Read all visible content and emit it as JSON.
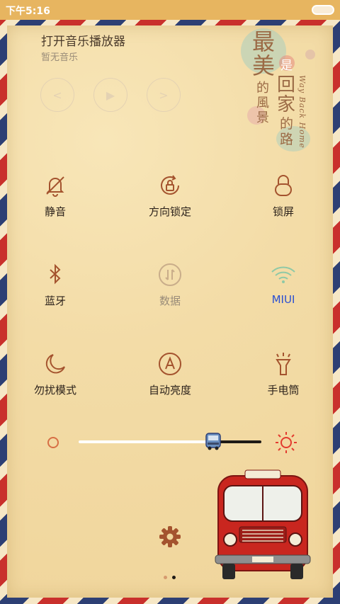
{
  "status_bar": {
    "time": "下午5:16"
  },
  "music": {
    "title": "打开音乐播放器",
    "subtitle": "暂无音乐"
  },
  "decor": {
    "line1": "最美",
    "line2": "的風景",
    "line3": "是",
    "line4": "回家",
    "line5": "的路",
    "english": "Way Back Home"
  },
  "toggles": [
    {
      "label": "静音",
      "icon": "bell-off-icon"
    },
    {
      "label": "方向锁定",
      "icon": "rotation-lock-icon"
    },
    {
      "label": "锁屏",
      "icon": "lock-icon"
    },
    {
      "label": "蓝牙",
      "icon": "bluetooth-icon"
    },
    {
      "label": "数据",
      "icon": "data-icon"
    },
    {
      "label": "MIUI",
      "icon": "wifi-icon"
    },
    {
      "label": "勿扰模式",
      "icon": "moon-icon"
    },
    {
      "label": "自动亮度",
      "icon": "auto-brightness-icon"
    },
    {
      "label": "手电筒",
      "icon": "flashlight-icon"
    }
  ],
  "brightness": {
    "level": 0.73
  },
  "pager": {
    "count": 2,
    "active": 1
  },
  "colors": {
    "accent": "#a4532e",
    "wifi_active": "#2a4fd2",
    "disabled": "#9a8c79",
    "sun": "#e33b2f"
  }
}
